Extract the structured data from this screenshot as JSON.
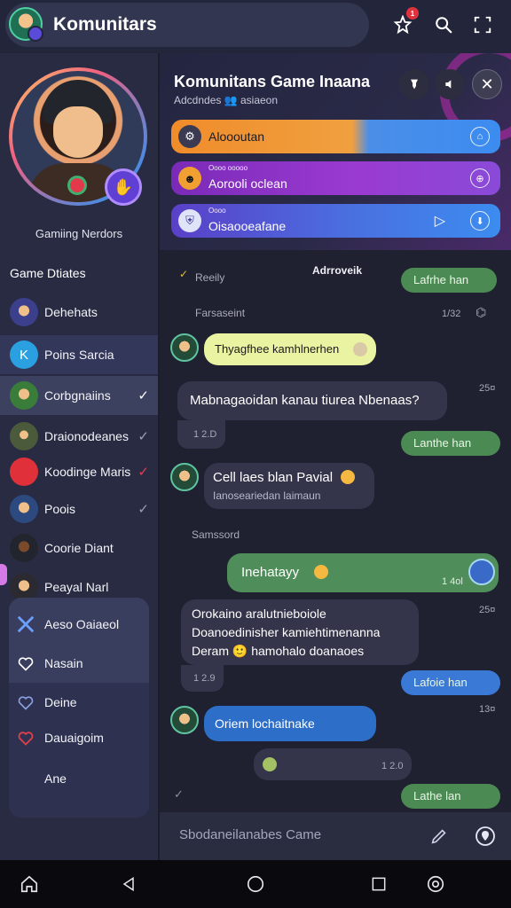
{
  "app": {
    "title": "Komunitars"
  },
  "topbar": {
    "notification_count": "1",
    "icons": [
      "notifications-icon",
      "search-icon",
      "expand-icon"
    ]
  },
  "sidebar": {
    "profile_name": "Gamiing Nerdors",
    "section_title": "Game Dtiates",
    "items": [
      {
        "label": "Dehehats",
        "check": ""
      },
      {
        "label": "Poins Sarcia",
        "check": ""
      },
      {
        "label": "Corbgnaiins",
        "check": "✓"
      },
      {
        "label": "Draionodeanes",
        "check": "✓"
      },
      {
        "label": "Koodinge Maris",
        "check": "✓"
      },
      {
        "label": "Poois",
        "check": "✓"
      },
      {
        "label": "Coorie Diant",
        "check": ""
      },
      {
        "label": "Peayal Narl",
        "check": ""
      }
    ],
    "card_items": [
      {
        "label": "Aeso Oaiaeol"
      },
      {
        "label": "Nasain"
      },
      {
        "label": "Deine"
      },
      {
        "label": "Dauaigoim"
      },
      {
        "label": "Ane"
      }
    ]
  },
  "header": {
    "group_title": "Komunitans Game Inaana",
    "group_subtitle": "Adcdndes 👥 asiaeon",
    "banners": [
      {
        "text": "Aloooutan",
        "small": ""
      },
      {
        "text": "Aorooli oclean",
        "small": "Oooo   ooooo"
      },
      {
        "text": "Oisaooeafane",
        "small": "Oooo"
      }
    ]
  },
  "chat": {
    "messages": [
      {
        "kind": "system",
        "text": "Reeily"
      },
      {
        "kind": "system",
        "text": "Adrroveik"
      },
      {
        "kind": "label",
        "text": "Lafrhe han"
      },
      {
        "kind": "system",
        "text": "Farsaseint"
      },
      {
        "kind": "timestamp",
        "text": "1/32"
      },
      {
        "kind": "incoming",
        "text": "Thyagfhee kamhlnerhen"
      },
      {
        "kind": "incoming",
        "text": "Mabnagaoidan kanau tiurea Nbenaas?"
      },
      {
        "kind": "timestamp",
        "text": "25¤"
      },
      {
        "kind": "timestamp",
        "text": "1 2.D"
      },
      {
        "kind": "label",
        "text": "Lanthe han"
      },
      {
        "kind": "incoming",
        "text": "Cell laes blan Pavial"
      },
      {
        "kind": "incoming_sub",
        "text": "Ianoseariedan laimaun"
      },
      {
        "kind": "system",
        "text": "Samssord"
      },
      {
        "kind": "outgoing",
        "text": "Inehatayy"
      },
      {
        "kind": "timestamp",
        "text": "1 4ol"
      },
      {
        "kind": "incoming",
        "text": "Orokaino aralutnieboiole"
      },
      {
        "kind": "incoming",
        "text": "Doanoedinisher kamiehtimenanna"
      },
      {
        "kind": "incoming",
        "text": "Deram 🙂 hamohalo doanaoes"
      },
      {
        "kind": "timestamp",
        "text": "25¤"
      },
      {
        "kind": "timestamp",
        "text": "1 2.9"
      },
      {
        "kind": "label_blue",
        "text": "Lafoie han"
      },
      {
        "kind": "timestamp",
        "text": "13¤"
      },
      {
        "kind": "incoming_blue",
        "text": "Oriem lochaitnake"
      },
      {
        "kind": "timestamp",
        "text": "1 2.0"
      },
      {
        "kind": "label",
        "text": "Lathe lan"
      }
    ]
  },
  "composer": {
    "placeholder": "Sbodaneilanabes Came"
  },
  "colors": {
    "accent_green": "#4f8e5a",
    "accent_blue": "#2c6ec8",
    "banner_orange": "#f08c2a",
    "banner_purple": "#8a3cc8"
  }
}
